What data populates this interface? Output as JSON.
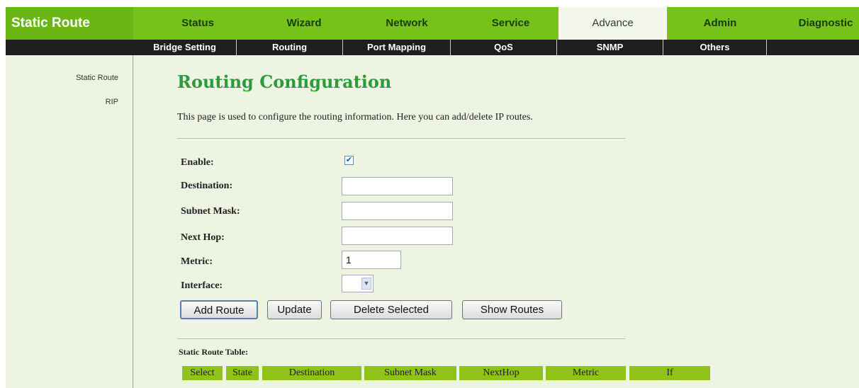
{
  "brand": "Static Route",
  "tabs": [
    {
      "label": "Status"
    },
    {
      "label": "Wizard"
    },
    {
      "label": "Network"
    },
    {
      "label": "Service"
    },
    {
      "label": "Advance",
      "active": true
    },
    {
      "label": "Admin"
    },
    {
      "label": "Diagnostic"
    }
  ],
  "subnav": [
    "Bridge Setting",
    "Routing",
    "Port Mapping",
    "QoS",
    "SNMP",
    "Others"
  ],
  "leftnav": [
    "Static Route",
    "RIP"
  ],
  "page": {
    "title": "Routing Configuration",
    "description": "This page is used to configure the routing information. Here you can add/delete IP routes."
  },
  "form": {
    "enable_label": "Enable:",
    "enable_checked": true,
    "destination_label": "Destination:",
    "destination_value": "",
    "subnet_label": "Subnet Mask:",
    "subnet_value": "",
    "nexthop_label": "Next Hop:",
    "nexthop_value": "",
    "metric_label": "Metric:",
    "metric_value": "1",
    "interface_label": "Interface:",
    "interface_value": ""
  },
  "buttons": {
    "add": "Add Route",
    "update": "Update",
    "delete": "Delete Selected",
    "show": "Show Routes"
  },
  "table": {
    "label": "Static Route Table:",
    "headers": [
      "Select",
      "State",
      "Destination",
      "Subnet Mask",
      "NextHop",
      "Metric",
      "If"
    ]
  },
  "colors": {
    "nav_green": "#76c21b",
    "title_green": "#2d9a3c",
    "page_bg": "#eef4e2",
    "header_green": "#8fc21a"
  }
}
